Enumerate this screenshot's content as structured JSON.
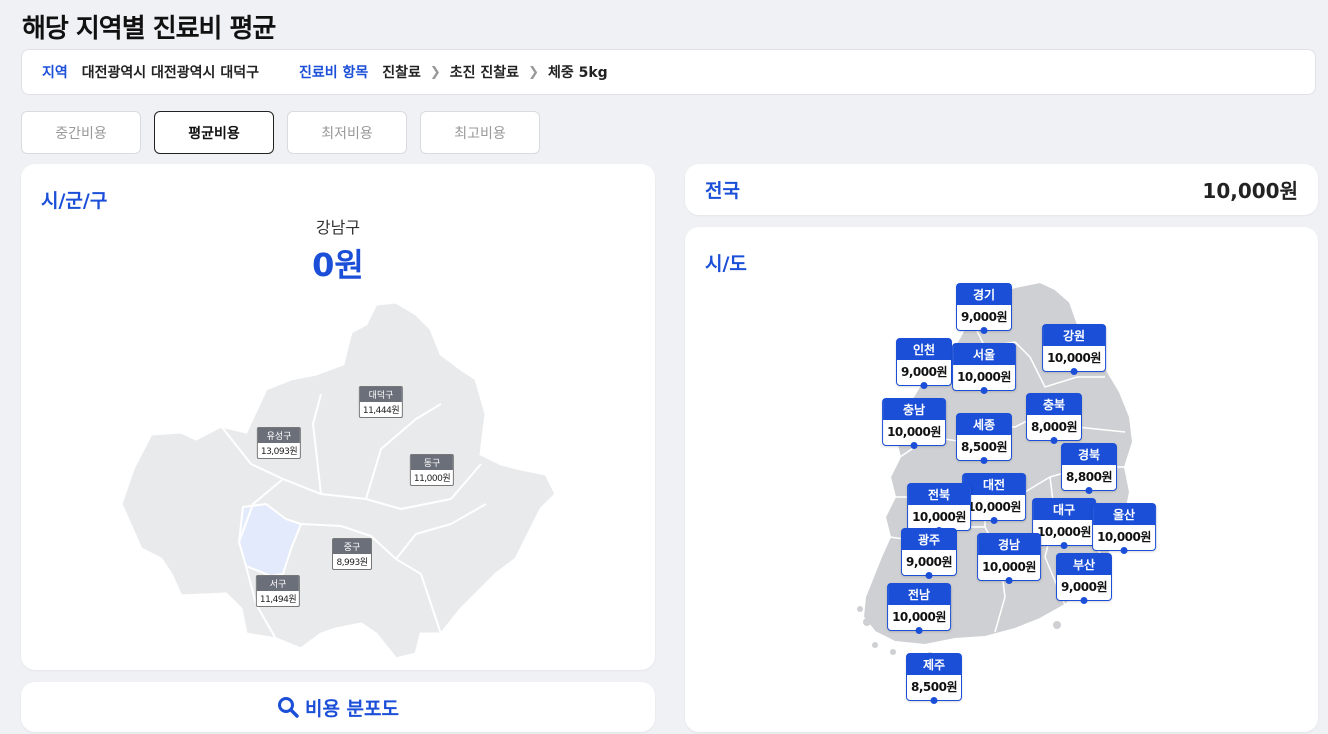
{
  "page_title": "해당 지역별 진료비 평균",
  "filter": {
    "region_label": "지역",
    "region_value": "대전광역시 대전광역시 대덕구",
    "item_label": "진료비 항목",
    "path": [
      "진찰료",
      "초진 진찰료",
      "체중 5kg"
    ]
  },
  "tabs": [
    "중간비용",
    "평균비용",
    "최저비용",
    "최고비용"
  ],
  "active_tab": "평균비용",
  "left_card": {
    "title": "시/군/구",
    "selected_name": "강남구",
    "selected_value": "0원"
  },
  "gu_markers": [
    {
      "name": "대덕구",
      "value": "11,444원"
    },
    {
      "name": "유성구",
      "value": "13,093원"
    },
    {
      "name": "동구",
      "value": "11,000원"
    },
    {
      "name": "중구",
      "value": "8,993원"
    },
    {
      "name": "서구",
      "value": "11,494원"
    }
  ],
  "search_button": "비용 분포도",
  "nation": {
    "label": "전국",
    "value": "10,000원"
  },
  "sido_card": {
    "title": "시/도"
  },
  "sido_markers": [
    {
      "name": "경기",
      "value": "9,000원"
    },
    {
      "name": "강원",
      "value": "10,000원"
    },
    {
      "name": "인천",
      "value": "9,000원"
    },
    {
      "name": "서울",
      "value": "10,000원"
    },
    {
      "name": "충남",
      "value": "10,000원"
    },
    {
      "name": "세종",
      "value": "8,500원"
    },
    {
      "name": "충북",
      "value": "8,000원"
    },
    {
      "name": "경북",
      "value": "8,800원"
    },
    {
      "name": "대전",
      "value": "10,000원"
    },
    {
      "name": "전북",
      "value": "10,000원"
    },
    {
      "name": "대구",
      "value": "10,000원"
    },
    {
      "name": "울산",
      "value": "10,000원"
    },
    {
      "name": "광주",
      "value": "9,000원"
    },
    {
      "name": "경남",
      "value": "10,000원"
    },
    {
      "name": "부산",
      "value": "9,000원"
    },
    {
      "name": "전남",
      "value": "10,000원"
    },
    {
      "name": "제주",
      "value": "8,500원"
    }
  ],
  "colors": {
    "accent": "#1b4fd8",
    "map_fill": "#cfd0d3",
    "highlight": "#e3eafb"
  }
}
